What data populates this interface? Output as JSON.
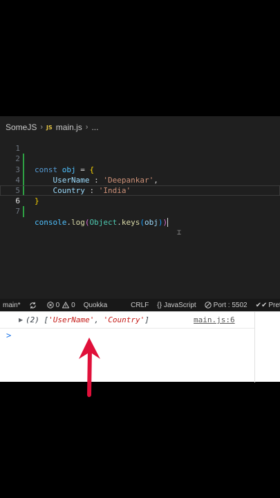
{
  "breadcrumb": {
    "folder": "SomeJS",
    "js_badge": "JS",
    "file": "main.js",
    "more": "..."
  },
  "code_lines": [
    {
      "num": "1"
    },
    {
      "num": "2"
    },
    {
      "num": "3"
    },
    {
      "num": "4"
    },
    {
      "num": "5"
    },
    {
      "num": "6"
    },
    {
      "num": "7"
    }
  ],
  "code": {
    "l1": {
      "kw": "const",
      "var": "obj",
      "eq": " = ",
      "brace": "{"
    },
    "l2": {
      "prop": "UserName",
      "colon": " : ",
      "str": "'Deepankar'",
      "comma": ","
    },
    "l3": {
      "prop": "Country",
      "colon": " : ",
      "str": "'India'"
    },
    "l4": {
      "brace": "}"
    },
    "l6": {
      "obj": "console",
      "dot1": ".",
      "fn": "log",
      "p1": "(",
      "cls": "Object",
      "dot2": ".",
      "fn2": "keys",
      "p2": "(",
      "arg": "obj",
      "p3": ")",
      "p4": ")"
    }
  },
  "statusbar": {
    "branch": "main*",
    "errors": "0",
    "warnings": "0",
    "quokka": "Quokka",
    "eol": "CRLF",
    "language": "JavaScript",
    "port": "Port : 5502",
    "prettier": "Prettier"
  },
  "console": {
    "count": "(2)",
    "open": "[",
    "item1": "'UserName'",
    "sep": ", ",
    "item2": "'Country'",
    "close": "]",
    "source": "main.js:6",
    "prompt": ">"
  },
  "colors": {
    "arrow": "#e0103a",
    "editor_bg": "#1f1f1f",
    "statusbar_bg": "#181818",
    "git_added": "#2ea043"
  },
  "icons": [
    "sync-icon",
    "error-icon",
    "warning-icon",
    "braces-icon",
    "broadcast-icon",
    "double-check-icon",
    "expand-triangle-icon",
    "arrow-up-icon"
  ]
}
